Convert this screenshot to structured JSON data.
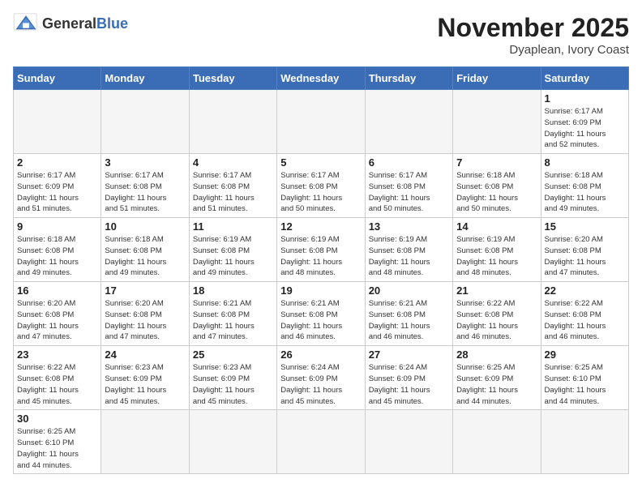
{
  "header": {
    "logo_general": "General",
    "logo_blue": "Blue",
    "month_year": "November 2025",
    "location": "Dyaplean, Ivory Coast"
  },
  "days_of_week": [
    "Sunday",
    "Monday",
    "Tuesday",
    "Wednesday",
    "Thursday",
    "Friday",
    "Saturday"
  ],
  "weeks": [
    [
      {
        "day": "",
        "info": ""
      },
      {
        "day": "",
        "info": ""
      },
      {
        "day": "",
        "info": ""
      },
      {
        "day": "",
        "info": ""
      },
      {
        "day": "",
        "info": ""
      },
      {
        "day": "",
        "info": ""
      },
      {
        "day": "1",
        "info": "Sunrise: 6:17 AM\nSunset: 6:09 PM\nDaylight: 11 hours\nand 52 minutes."
      }
    ],
    [
      {
        "day": "2",
        "info": "Sunrise: 6:17 AM\nSunset: 6:09 PM\nDaylight: 11 hours\nand 51 minutes."
      },
      {
        "day": "3",
        "info": "Sunrise: 6:17 AM\nSunset: 6:08 PM\nDaylight: 11 hours\nand 51 minutes."
      },
      {
        "day": "4",
        "info": "Sunrise: 6:17 AM\nSunset: 6:08 PM\nDaylight: 11 hours\nand 51 minutes."
      },
      {
        "day": "5",
        "info": "Sunrise: 6:17 AM\nSunset: 6:08 PM\nDaylight: 11 hours\nand 50 minutes."
      },
      {
        "day": "6",
        "info": "Sunrise: 6:17 AM\nSunset: 6:08 PM\nDaylight: 11 hours\nand 50 minutes."
      },
      {
        "day": "7",
        "info": "Sunrise: 6:18 AM\nSunset: 6:08 PM\nDaylight: 11 hours\nand 50 minutes."
      },
      {
        "day": "8",
        "info": "Sunrise: 6:18 AM\nSunset: 6:08 PM\nDaylight: 11 hours\nand 49 minutes."
      }
    ],
    [
      {
        "day": "9",
        "info": "Sunrise: 6:18 AM\nSunset: 6:08 PM\nDaylight: 11 hours\nand 49 minutes."
      },
      {
        "day": "10",
        "info": "Sunrise: 6:18 AM\nSunset: 6:08 PM\nDaylight: 11 hours\nand 49 minutes."
      },
      {
        "day": "11",
        "info": "Sunrise: 6:19 AM\nSunset: 6:08 PM\nDaylight: 11 hours\nand 49 minutes."
      },
      {
        "day": "12",
        "info": "Sunrise: 6:19 AM\nSunset: 6:08 PM\nDaylight: 11 hours\nand 48 minutes."
      },
      {
        "day": "13",
        "info": "Sunrise: 6:19 AM\nSunset: 6:08 PM\nDaylight: 11 hours\nand 48 minutes."
      },
      {
        "day": "14",
        "info": "Sunrise: 6:19 AM\nSunset: 6:08 PM\nDaylight: 11 hours\nand 48 minutes."
      },
      {
        "day": "15",
        "info": "Sunrise: 6:20 AM\nSunset: 6:08 PM\nDaylight: 11 hours\nand 47 minutes."
      }
    ],
    [
      {
        "day": "16",
        "info": "Sunrise: 6:20 AM\nSunset: 6:08 PM\nDaylight: 11 hours\nand 47 minutes."
      },
      {
        "day": "17",
        "info": "Sunrise: 6:20 AM\nSunset: 6:08 PM\nDaylight: 11 hours\nand 47 minutes."
      },
      {
        "day": "18",
        "info": "Sunrise: 6:21 AM\nSunset: 6:08 PM\nDaylight: 11 hours\nand 47 minutes."
      },
      {
        "day": "19",
        "info": "Sunrise: 6:21 AM\nSunset: 6:08 PM\nDaylight: 11 hours\nand 46 minutes."
      },
      {
        "day": "20",
        "info": "Sunrise: 6:21 AM\nSunset: 6:08 PM\nDaylight: 11 hours\nand 46 minutes."
      },
      {
        "day": "21",
        "info": "Sunrise: 6:22 AM\nSunset: 6:08 PM\nDaylight: 11 hours\nand 46 minutes."
      },
      {
        "day": "22",
        "info": "Sunrise: 6:22 AM\nSunset: 6:08 PM\nDaylight: 11 hours\nand 46 minutes."
      }
    ],
    [
      {
        "day": "23",
        "info": "Sunrise: 6:22 AM\nSunset: 6:08 PM\nDaylight: 11 hours\nand 45 minutes."
      },
      {
        "day": "24",
        "info": "Sunrise: 6:23 AM\nSunset: 6:09 PM\nDaylight: 11 hours\nand 45 minutes."
      },
      {
        "day": "25",
        "info": "Sunrise: 6:23 AM\nSunset: 6:09 PM\nDaylight: 11 hours\nand 45 minutes."
      },
      {
        "day": "26",
        "info": "Sunrise: 6:24 AM\nSunset: 6:09 PM\nDaylight: 11 hours\nand 45 minutes."
      },
      {
        "day": "27",
        "info": "Sunrise: 6:24 AM\nSunset: 6:09 PM\nDaylight: 11 hours\nand 45 minutes."
      },
      {
        "day": "28",
        "info": "Sunrise: 6:25 AM\nSunset: 6:09 PM\nDaylight: 11 hours\nand 44 minutes."
      },
      {
        "day": "29",
        "info": "Sunrise: 6:25 AM\nSunset: 6:10 PM\nDaylight: 11 hours\nand 44 minutes."
      }
    ],
    [
      {
        "day": "30",
        "info": "Sunrise: 6:25 AM\nSunset: 6:10 PM\nDaylight: 11 hours\nand 44 minutes."
      },
      {
        "day": "",
        "info": ""
      },
      {
        "day": "",
        "info": ""
      },
      {
        "day": "",
        "info": ""
      },
      {
        "day": "",
        "info": ""
      },
      {
        "day": "",
        "info": ""
      },
      {
        "day": "",
        "info": ""
      }
    ]
  ]
}
